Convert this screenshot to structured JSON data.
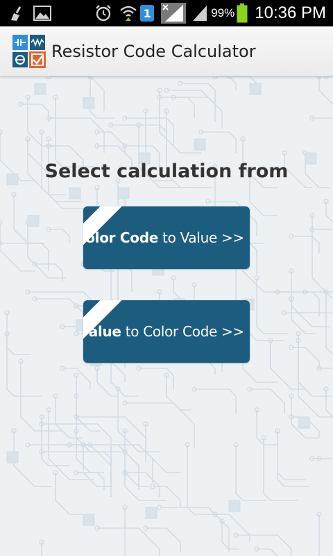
{
  "status_bar": {
    "notification_badge": "1",
    "battery_percent": "99%",
    "time": "10:36 PM"
  },
  "action_bar": {
    "title": "Resistor Code Calculator"
  },
  "main": {
    "prompt": "Select calculation from",
    "buttons": [
      {
        "bold": "Color Code",
        "rest": " to Value >>"
      },
      {
        "bold": "Value",
        "rest": " to Color Code >>"
      }
    ]
  },
  "colors": {
    "button_bg": "#1c5d7f",
    "background": "#eef1f4",
    "action_bar": "#f2f2f2",
    "status_bar": "#000000",
    "battery": "#8cd31d",
    "logo_blue": "#2f8fd8",
    "logo_orange": "#e4662f"
  }
}
